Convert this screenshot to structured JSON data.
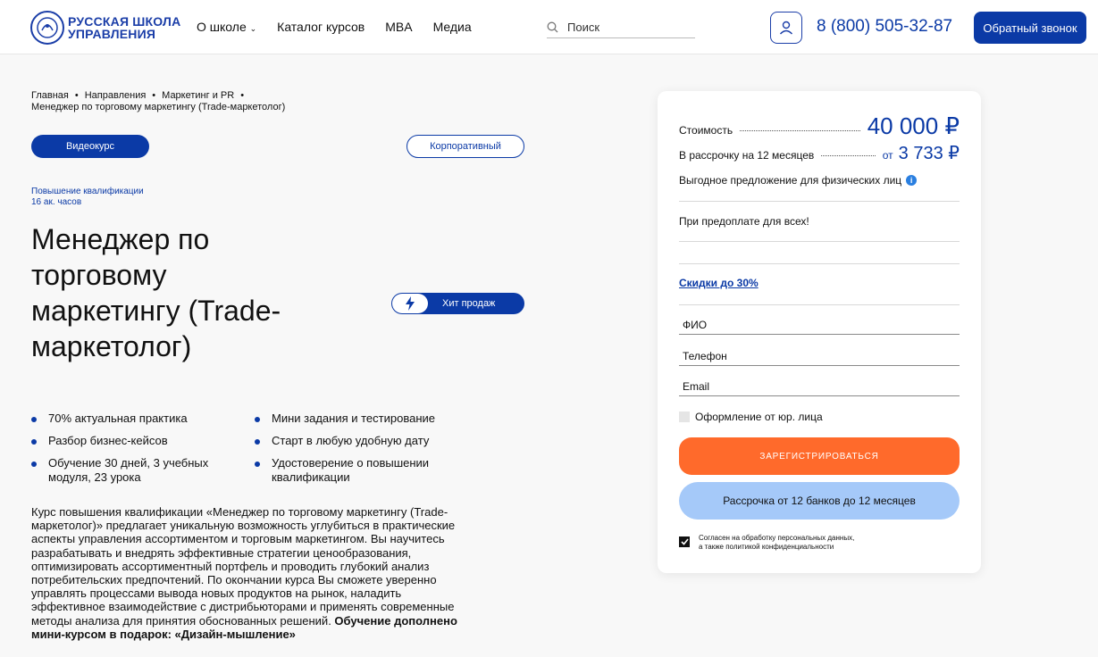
{
  "header": {
    "logo_line1": "РУССКАЯ ШКОЛА",
    "logo_line2": "УПРАВЛЕНИЯ",
    "nav": [
      "О школе",
      "Каталог курсов",
      "MBA",
      "Медиа"
    ],
    "search_placeholder": "Поиск",
    "phone": "8 (800) 505-32-87",
    "callback_label": "Обратный звонок"
  },
  "breadcrumb": [
    "Главная",
    "Направления",
    "Маркетинг и PR",
    "Менеджер по торговому маркетингу (Trade-маркетолог)"
  ],
  "tags": {
    "video": "Видеокурс",
    "corporate": "Корпоративный"
  },
  "meta": {
    "type": "Повышение квалификации",
    "hours": "16 ак. часов"
  },
  "title": "Менеджер по торговому маркетингу (Trade-маркетолог)",
  "hit_label": "Хит продаж",
  "features": [
    "70% актуальная практика",
    "Мини задания и тестирование",
    "Разбор бизнес-кейсов",
    "Старт в любую удобную дату",
    "Обучение 30 дней, 3 учебных модуля, 23 урока",
    "Удостоверение о повышении квалификации"
  ],
  "description": "Курс повышения квалификации «Менеджер по торговому маркетингу (Trade-маркетолог)» предлагает уникальную возможность углубиться в практические аспекты управления ассортиментом и торговым маркетингом. Вы научитесь разрабатывать и внедрять эффективные стратегии ценообразования, оптимизировать ассортиментный портфель и проводить глубокий анализ потребительских предпочтений. По окончании курса Вы сможете уверенно управлять процессами вывода новых продуктов на рынок, наладить эффективное взаимодействие с дистрибьюторами и применять современные методы анализа для принятия обоснованных решений. ",
  "description_bold": "Обучение дополнено мини-курсом в подарок: «Дизайн-мышление»",
  "card": {
    "price_label": "Стоимость",
    "price": "40 000 ₽",
    "installment_label": "В рассрочку на 12 месяцев",
    "installment_prefix": "от",
    "installment_price": "3 733 ₽",
    "offer": "Выгодное предложение для физических лиц",
    "info_icon": "i",
    "prepay": "При предоплате для всех!",
    "discount": "Скидки до 30%",
    "fields": [
      "ФИО",
      "Телефон",
      "Email"
    ],
    "legal_entity": "Оформление от юр. лица",
    "register_label": "ЗАРЕГИСТРИРОВАТЬСЯ",
    "installment_button": "Рассрочка от 12 банков до 12 месяцев",
    "consent_line1": "Согласен на обработку персональных данных,",
    "consent_line2": "а также политикой конфиденциальности"
  },
  "colors": {
    "brand": "#0b3aa6",
    "accent": "#ff6a2b",
    "light_blue": "#a5c9f9"
  }
}
